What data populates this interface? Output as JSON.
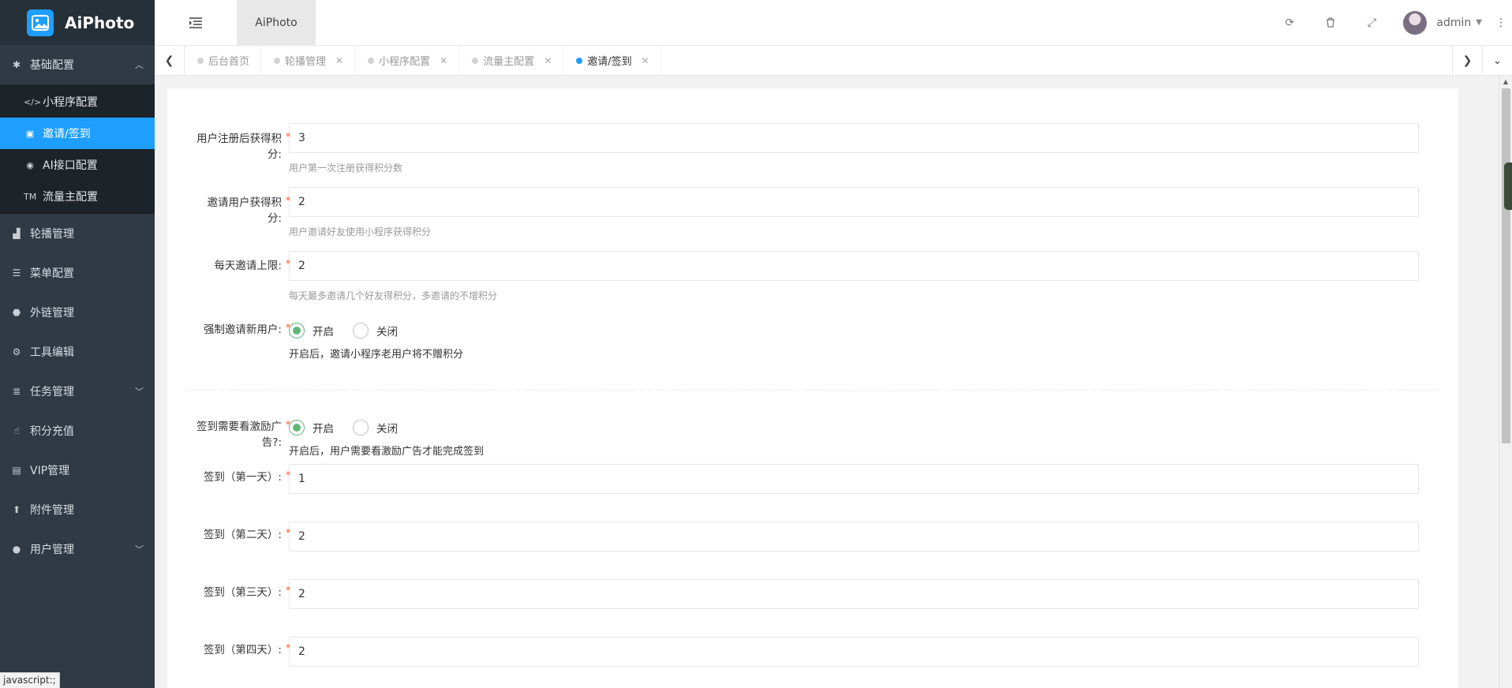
{
  "brand": {
    "name": "AiPhoto"
  },
  "sidebar": {
    "group": {
      "label": "基础配置",
      "icon": "asterisk-icon"
    },
    "sub_items": [
      {
        "label": "小程序配置",
        "icon": "code-icon"
      },
      {
        "label": "邀请/签到",
        "icon": "contact-card-icon",
        "active": true
      },
      {
        "label": "AI接口配置",
        "icon": "chrome-icon"
      },
      {
        "label": "流量主配置",
        "icon": "trademark-icon"
      }
    ],
    "items": [
      {
        "label": "轮播管理",
        "icon": "area-chart-icon"
      },
      {
        "label": "菜单配置",
        "icon": "bars-icon"
      },
      {
        "label": "外链管理",
        "icon": "android-icon"
      },
      {
        "label": "工具编辑",
        "icon": "gear-icon"
      },
      {
        "label": "任务管理",
        "icon": "list-icon",
        "arrow": true
      },
      {
        "label": "积分充值",
        "icon": "hand-pointer-icon"
      },
      {
        "label": "VIP管理",
        "icon": "id-card-icon"
      },
      {
        "label": "附件管理",
        "icon": "arrow-up-icon"
      },
      {
        "label": "用户管理",
        "icon": "user-icon",
        "arrow": true
      }
    ]
  },
  "status_bar": "javascript:;",
  "header": {
    "app_tab": "AiPhoto",
    "user": "admin"
  },
  "tabs": [
    {
      "label": "后台首页",
      "closable": false
    },
    {
      "label": "轮播管理",
      "closable": true
    },
    {
      "label": "小程序配置",
      "closable": true
    },
    {
      "label": "流量主配置",
      "closable": true
    },
    {
      "label": "邀请/签到",
      "closable": true,
      "active": true
    }
  ],
  "form": {
    "register_points": {
      "label": "用户注册后获得积分:",
      "value": "3",
      "hint": "用户第一次注册获得积分数"
    },
    "invite_points": {
      "label": "邀请用户获得积分:",
      "value": "2",
      "hint": "用户邀请好友使用小程序获得积分"
    },
    "daily_limit": {
      "label": "每天邀请上限:",
      "value": "2",
      "hint": "每天最多邀请几个好友得积分，多邀请的不增积分"
    },
    "force_new": {
      "label": "强制邀请新用户:",
      "on": "开启",
      "off": "关闭",
      "selected": "on",
      "note": "开启后，邀请小程序老用户将不赠积分"
    },
    "sign_ad": {
      "label": "签到需要看激励广告?:",
      "on": "开启",
      "off": "关闭",
      "selected": "on",
      "note": "开启后，用户需要看激励广告才能完成签到"
    },
    "sign_days": [
      {
        "label": "签到（第一天）:",
        "value": "1"
      },
      {
        "label": "签到（第二天）:",
        "value": "2"
      },
      {
        "label": "签到（第三天）:",
        "value": "2"
      },
      {
        "label": "签到（第四天）:",
        "value": "2"
      }
    ]
  }
}
